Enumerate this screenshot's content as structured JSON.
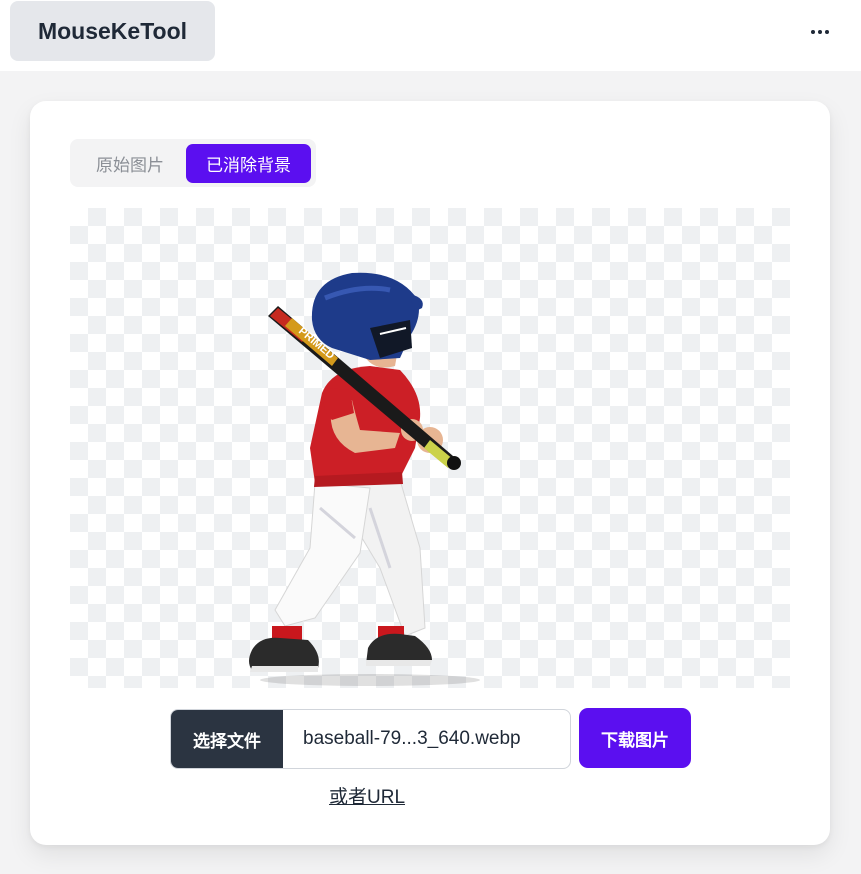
{
  "app": {
    "brand": "MouseKeTool"
  },
  "header": {
    "more_icon": "more-horizontal-icon"
  },
  "tabs": [
    {
      "label": "原始图片",
      "active": false
    },
    {
      "label": "已消除背景",
      "active": true
    }
  ],
  "preview": {
    "subject": "baseball-player-cutout",
    "bat_text": "PRIMED"
  },
  "file_input": {
    "button_label": "选择文件",
    "file_name": "baseball-79...3_640.webp"
  },
  "actions": {
    "download_label": "下载图片",
    "url_link": "或者URL"
  },
  "colors": {
    "accent": "#5b0ff0",
    "file_button_bg": "#2b3441",
    "checker": "#eef0f2"
  }
}
